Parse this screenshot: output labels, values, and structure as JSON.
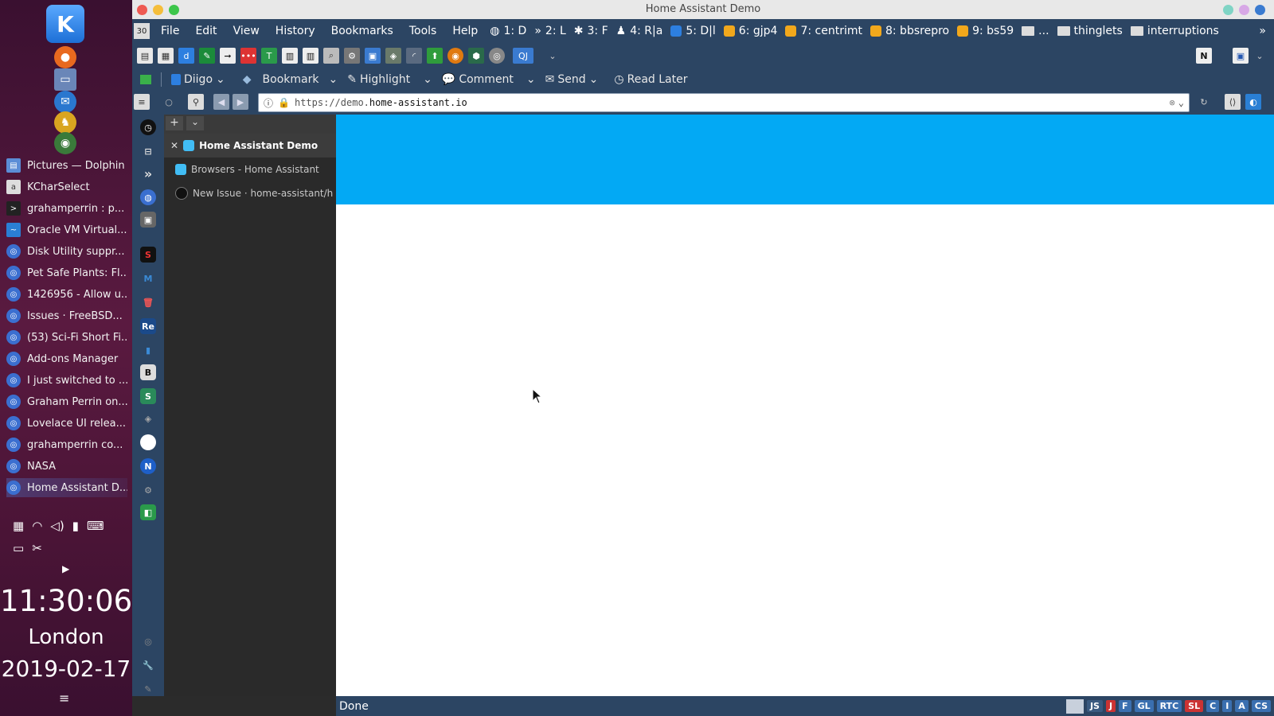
{
  "window": {
    "title": "Home Assistant Demo"
  },
  "menubar": {
    "items": [
      "File",
      "Edit",
      "View",
      "History",
      "Bookmarks",
      "Tools",
      "Help"
    ],
    "bookmarks": [
      "1: D",
      "2: L",
      "3: F",
      "4: R|a",
      "5: D|l",
      "6: gjp4",
      "7: centrimt",
      "8: bbsrepro",
      "9: bs59",
      "...",
      "thinglets",
      "interruptions"
    ],
    "overflow": "»"
  },
  "toolbar2": {
    "diigo": "Diigo",
    "bookmark": "Bookmark",
    "highlight": "Highlight",
    "comment": "Comment",
    "send": "Send",
    "read_later": "Read Later"
  },
  "urlbar": {
    "url_prefix": "https://demo.",
    "url_domain": "home-assistant.io"
  },
  "tabs": [
    {
      "title": "Home Assistant Demo",
      "active": true
    },
    {
      "title": "Browsers - Home Assistant",
      "active": false
    },
    {
      "title": "New Issue · home-assistant/h",
      "active": false
    }
  ],
  "taskbar": {
    "tasks": [
      "Pictures — Dolphin",
      "KCharSelect",
      "grahamperrin : p...",
      "Oracle VM Virtual...",
      "Disk Utility suppr...",
      "Pet Safe Plants: Fl...",
      "1426956 - Allow u...",
      "Issues · FreeBSD...",
      "(53) Sci-Fi Short Fi...",
      "Add-ons Manager",
      "I just switched to ...",
      "Graham Perrin on...",
      "Lovelace UI relea...",
      "grahamperrin co...",
      "NASA",
      "Home Assistant D..."
    ]
  },
  "clock": {
    "time": "11:30:06",
    "city": "London",
    "date": "2019-02-17"
  },
  "status": {
    "text": "Done",
    "badges": [
      "JS",
      "J",
      "F",
      "GL",
      "RTC",
      "SL",
      "C",
      "I",
      "A",
      "CS"
    ]
  },
  "colors": {
    "ha_blue": "#03a9f4",
    "toolbar_bg": "#2c4563"
  }
}
